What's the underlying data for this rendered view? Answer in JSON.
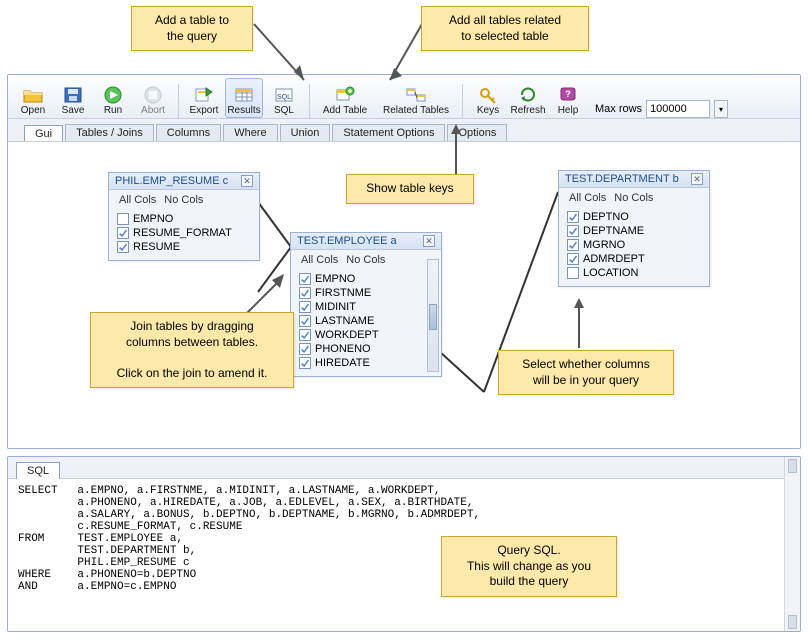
{
  "callouts": {
    "addTable": "Add a table to\nthe query",
    "relatedTables": "Add all tables related\nto selected table",
    "showKeys": "Show table keys",
    "joinHint": "Join tables by dragging\ncolumns between tables.\n\nClick on the join to amend it.",
    "selectCols": "Select whether columns\nwill be in your query",
    "querySql": "Query SQL.\nThis will change as you\nbuild the query"
  },
  "toolbar": {
    "open": "Open",
    "save": "Save",
    "run": "Run",
    "abort": "Abort",
    "export": "Export",
    "results": "Results",
    "sql": "SQL",
    "addTable": "Add Table",
    "relatedTables": "Related Tables",
    "keys": "Keys",
    "refresh": "Refresh",
    "help": "Help",
    "maxRowsLabel": "Max rows",
    "maxRowsValue": "100000"
  },
  "tabs": {
    "gui": "Gui",
    "tablesJoins": "Tables / Joins",
    "columns": "Columns",
    "where": "Where",
    "union": "Union",
    "statementOptions": "Statement Options",
    "options": "Options"
  },
  "colActions": {
    "all": "All Cols",
    "none": "No Cols"
  },
  "tables": {
    "resume": {
      "title": "PHIL.EMP_RESUME c",
      "cols": [
        {
          "name": "EMPNO",
          "on": false
        },
        {
          "name": "RESUME_FORMAT",
          "on": true
        },
        {
          "name": "RESUME",
          "on": true
        }
      ]
    },
    "employee": {
      "title": "TEST.EMPLOYEE a",
      "cols": [
        {
          "name": "EMPNO",
          "on": true
        },
        {
          "name": "FIRSTNME",
          "on": true
        },
        {
          "name": "MIDINIT",
          "on": true
        },
        {
          "name": "LASTNAME",
          "on": true
        },
        {
          "name": "WORKDEPT",
          "on": true
        },
        {
          "name": "PHONENO",
          "on": true
        },
        {
          "name": "HIREDATE",
          "on": true
        }
      ]
    },
    "department": {
      "title": "TEST.DEPARTMENT b",
      "cols": [
        {
          "name": "DEPTNO",
          "on": true
        },
        {
          "name": "DEPTNAME",
          "on": true
        },
        {
          "name": "MGRNO",
          "on": true
        },
        {
          "name": "ADMRDEPT",
          "on": true
        },
        {
          "name": "LOCATION",
          "on": false
        }
      ]
    }
  },
  "sql": {
    "tab": "SQL",
    "text": "SELECT   a.EMPNO, a.FIRSTNME, a.MIDINIT, a.LASTNAME, a.WORKDEPT,\n         a.PHONENO, a.HIREDATE, a.JOB, a.EDLEVEL, a.SEX, a.BIRTHDATE,\n         a.SALARY, a.BONUS, b.DEPTNO, b.DEPTNAME, b.MGRNO, b.ADMRDEPT,\n         c.RESUME_FORMAT, c.RESUME\nFROM     TEST.EMPLOYEE a,\n         TEST.DEPARTMENT b,\n         PHIL.EMP_RESUME c\nWHERE    a.PHONENO=b.DEPTNO\nAND      a.EMPNO=c.EMPNO"
  }
}
